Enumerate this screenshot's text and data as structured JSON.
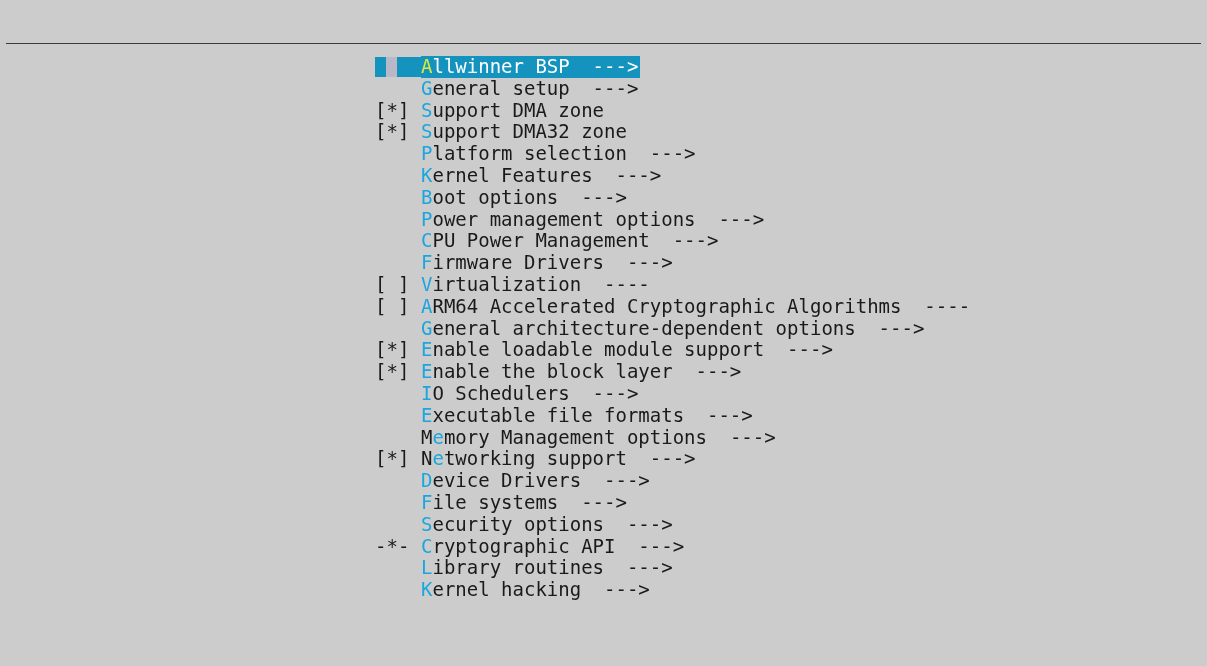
{
  "menu": {
    "items": [
      {
        "kind": "menu",
        "selected": true,
        "hotkey": "A",
        "post": "llwinner BSP",
        "suffix": "--->"
      },
      {
        "kind": "menu",
        "selected": false,
        "hotkey": "G",
        "post": "eneral setup",
        "suffix": "--->"
      },
      {
        "kind": "bool",
        "checked": true,
        "open": "[",
        "mark": "*",
        "close": "]",
        "selected": false,
        "hotkey": "S",
        "post": "upport DMA zone"
      },
      {
        "kind": "bool",
        "checked": true,
        "open": "[",
        "mark": "*",
        "close": "]",
        "selected": false,
        "hotkey": "S",
        "post": "upport DMA32 zone"
      },
      {
        "kind": "menu",
        "selected": false,
        "hotkey": "P",
        "post": "latform selection",
        "suffix": "--->"
      },
      {
        "kind": "menu",
        "selected": false,
        "hotkey": "K",
        "post": "ernel Features",
        "suffix": "--->"
      },
      {
        "kind": "menu",
        "selected": false,
        "hotkey": "B",
        "post": "oot options",
        "suffix": "--->"
      },
      {
        "kind": "menu",
        "selected": false,
        "hotkey": "P",
        "post": "ower management options",
        "suffix": "--->"
      },
      {
        "kind": "menu",
        "selected": false,
        "hotkey": "C",
        "post": "PU Power Management",
        "suffix": "--->"
      },
      {
        "kind": "menu",
        "selected": false,
        "hotkey": "F",
        "post": "irmware Drivers",
        "suffix": "--->"
      },
      {
        "kind": "bool",
        "checked": false,
        "open": "[",
        "close": "]",
        "selected": false,
        "hotkey": "V",
        "post": "irtualization",
        "suffix": "----"
      },
      {
        "kind": "bool",
        "checked": false,
        "open": "[",
        "close": "]",
        "selected": false,
        "hotkey": "A",
        "post": "RM64 Accelerated Cryptographic Algorithms",
        "suffix": "----"
      },
      {
        "kind": "menu",
        "selected": false,
        "hotkey": "G",
        "post": "eneral architecture-dependent options",
        "suffix": "--->"
      },
      {
        "kind": "bool",
        "checked": true,
        "open": "[",
        "mark": "*",
        "close": "]",
        "selected": false,
        "hotkey": "E",
        "post": "nable loadable module support",
        "suffix": "--->"
      },
      {
        "kind": "bool",
        "checked": true,
        "open": "[",
        "mark": "*",
        "close": "]",
        "selected": false,
        "hotkey": "E",
        "post": "nable the block layer",
        "suffix": "--->"
      },
      {
        "kind": "menu",
        "selected": false,
        "hotkey": "I",
        "post": "O Schedulers",
        "suffix": "--->"
      },
      {
        "kind": "menu",
        "selected": false,
        "hotkey": "E",
        "post": "xecutable file formats",
        "suffix": "--->"
      },
      {
        "kind": "menu",
        "selected": false,
        "pre": "M",
        "hotkey": "e",
        "post": "mory Management options",
        "suffix": "--->"
      },
      {
        "kind": "bool",
        "checked": true,
        "open": "[",
        "mark": "*",
        "close": "]",
        "selected": false,
        "pre": "N",
        "hotkey": "e",
        "post": "tworking support",
        "suffix": "--->"
      },
      {
        "kind": "menu",
        "selected": false,
        "hotkey": "D",
        "post": "evice Drivers",
        "suffix": "--->"
      },
      {
        "kind": "menu",
        "selected": false,
        "hotkey": "F",
        "post": "ile systems",
        "suffix": "--->"
      },
      {
        "kind": "menu",
        "selected": false,
        "hotkey": "S",
        "post": "ecurity options",
        "suffix": "--->"
      },
      {
        "kind": "forced",
        "prefix": "-*-",
        "selected": false,
        "hotkey": "C",
        "post": "ryptographic API",
        "suffix": "--->"
      },
      {
        "kind": "menu",
        "selected": false,
        "hotkey": "L",
        "post": "ibrary routines",
        "suffix": "--->"
      },
      {
        "kind": "menu",
        "selected": false,
        "hotkey": "K",
        "post": "ernel hacking",
        "suffix": "--->"
      }
    ]
  }
}
